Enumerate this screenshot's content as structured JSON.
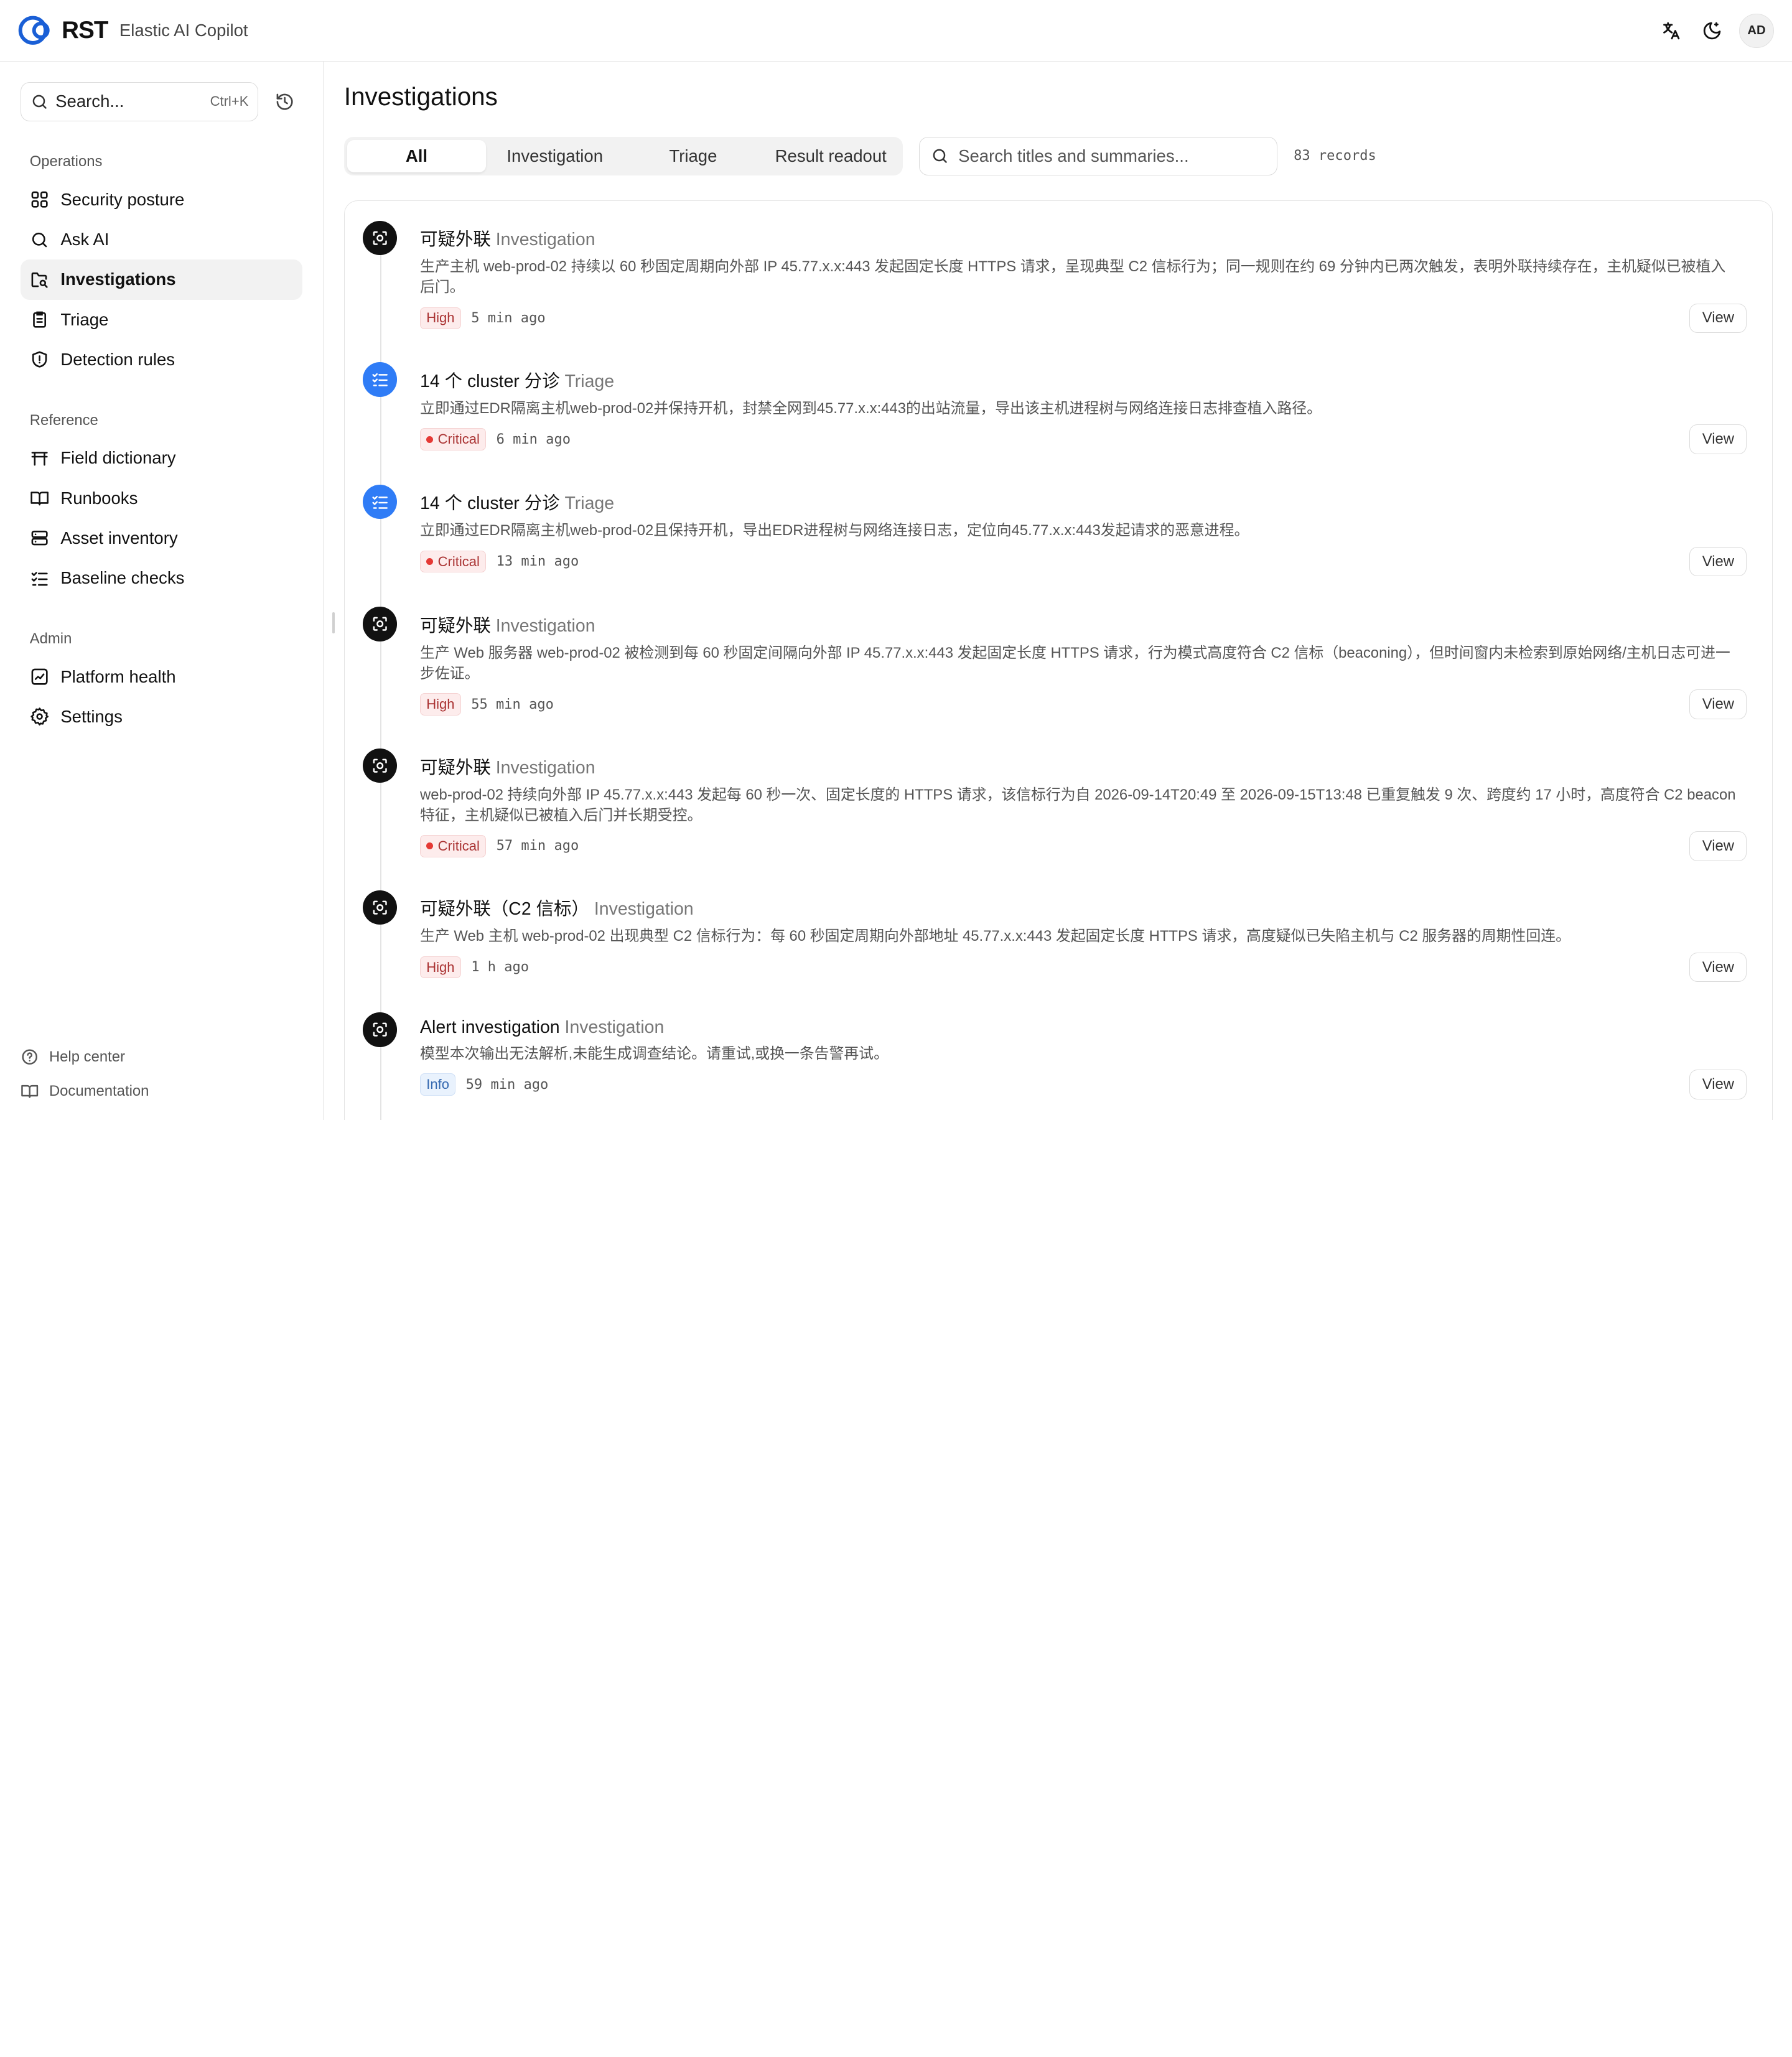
{
  "header": {
    "logo_text": "RST",
    "product_name": "Elastic AI Copilot",
    "avatar_initials": "AD",
    "icons": [
      "translate-icon",
      "theme-toggle-icon"
    ]
  },
  "sidebar": {
    "search_placeholder": "Search...",
    "search_shortcut": "Ctrl+K",
    "sections": [
      {
        "title": "Operations",
        "items": [
          {
            "label": "Security posture",
            "icon": "grid-icon",
            "active": false
          },
          {
            "label": "Ask AI",
            "icon": "search-icon",
            "active": false
          },
          {
            "label": "Investigations",
            "icon": "folder-search-icon",
            "active": true
          },
          {
            "label": "Triage",
            "icon": "clipboard-icon",
            "active": false
          },
          {
            "label": "Detection rules",
            "icon": "shield-alert-icon",
            "active": false
          }
        ]
      },
      {
        "title": "Reference",
        "items": [
          {
            "label": "Field dictionary",
            "icon": "table-icon",
            "active": false
          },
          {
            "label": "Runbooks",
            "icon": "book-icon",
            "active": false
          },
          {
            "label": "Asset inventory",
            "icon": "server-icon",
            "active": false
          },
          {
            "label": "Baseline checks",
            "icon": "checklist-icon",
            "active": false
          }
        ]
      },
      {
        "title": "Admin",
        "items": [
          {
            "label": "Platform health",
            "icon": "chart-icon",
            "active": false
          },
          {
            "label": "Settings",
            "icon": "gear-icon",
            "active": false
          }
        ]
      }
    ],
    "footer": [
      {
        "label": "Help center",
        "icon": "help-icon"
      },
      {
        "label": "Documentation",
        "icon": "book-icon"
      }
    ]
  },
  "main": {
    "title": "Investigations",
    "tabs": [
      {
        "label": "All",
        "active": true
      },
      {
        "label": "Investigation",
        "active": false
      },
      {
        "label": "Triage",
        "active": false
      },
      {
        "label": "Result readout",
        "active": false
      }
    ],
    "search_placeholder": "Search titles and summaries...",
    "records": "83 records",
    "view_label": "View",
    "items": [
      {
        "kind": "investigation",
        "title": "可疑外联",
        "type": "Investigation",
        "summary": "生产主机 web-prod-02 持续以 60 秒固定周期向外部 IP 45.77.x.x:443 发起固定长度 HTTPS 请求，呈现典型 C2 信标行为；同一规则在约 69 分钟内已两次触发，表明外联持续存在，主机疑似已被植入后门。",
        "severity": "High",
        "time": "5 min ago"
      },
      {
        "kind": "triage",
        "title": "14 个 cluster 分诊",
        "type": "Triage",
        "summary": "立即通过EDR隔离主机web-prod-02并保持开机，封禁全网到45.77.x.x:443的出站流量，导出该主机进程树与网络连接日志排查植入路径。",
        "severity": "Critical",
        "time": "6 min ago"
      },
      {
        "kind": "triage",
        "title": "14 个 cluster 分诊",
        "type": "Triage",
        "summary": "立即通过EDR隔离主机web-prod-02且保持开机，导出EDR进程树与网络连接日志，定位向45.77.x.x:443发起请求的恶意进程。",
        "severity": "Critical",
        "time": "13 min ago"
      },
      {
        "kind": "investigation",
        "title": "可疑外联",
        "type": "Investigation",
        "summary": "生产 Web 服务器 web-prod-02 被检测到每 60 秒固定间隔向外部 IP 45.77.x.x:443 发起固定长度 HTTPS 请求，行为模式高度符合 C2 信标（beaconing），但时间窗内未检索到原始网络/主机日志可进一步佐证。",
        "severity": "High",
        "time": "55 min ago"
      },
      {
        "kind": "investigation",
        "title": "可疑外联",
        "type": "Investigation",
        "summary": "web-prod-02 持续向外部 IP 45.77.x.x:443 发起每 60 秒一次、固定长度的 HTTPS 请求，该信标行为自 2026-09-14T20:49 至 2026-09-15T13:48 已重复触发 9 次、跨度约 17 小时，高度符合 C2 beacon 特征，主机疑似已被植入后门并长期受控。",
        "severity": "Critical",
        "time": "57 min ago"
      },
      {
        "kind": "investigation",
        "title": "可疑外联（C2 信标）",
        "type": "Investigation",
        "summary": "生产 Web 主机 web-prod-02 出现典型 C2 信标行为：每 60 秒固定周期向外部地址 45.77.x.x:443 发起固定长度 HTTPS 请求，高度疑似已失陷主机与 C2 服务器的周期性回连。",
        "severity": "High",
        "time": "1 h ago"
      },
      {
        "kind": "investigation",
        "title": "Alert investigation",
        "type": "Investigation",
        "summary": "模型本次输出无法解析,未能生成调查结论。请重试,或换一条告警再试。",
        "severity": "Info",
        "time": "59 min ago"
      }
    ]
  },
  "colors": {
    "accent_blue": "#2f7cf6",
    "critical_red": "#e53935",
    "active_nav_bg": "#f2f2f2"
  }
}
